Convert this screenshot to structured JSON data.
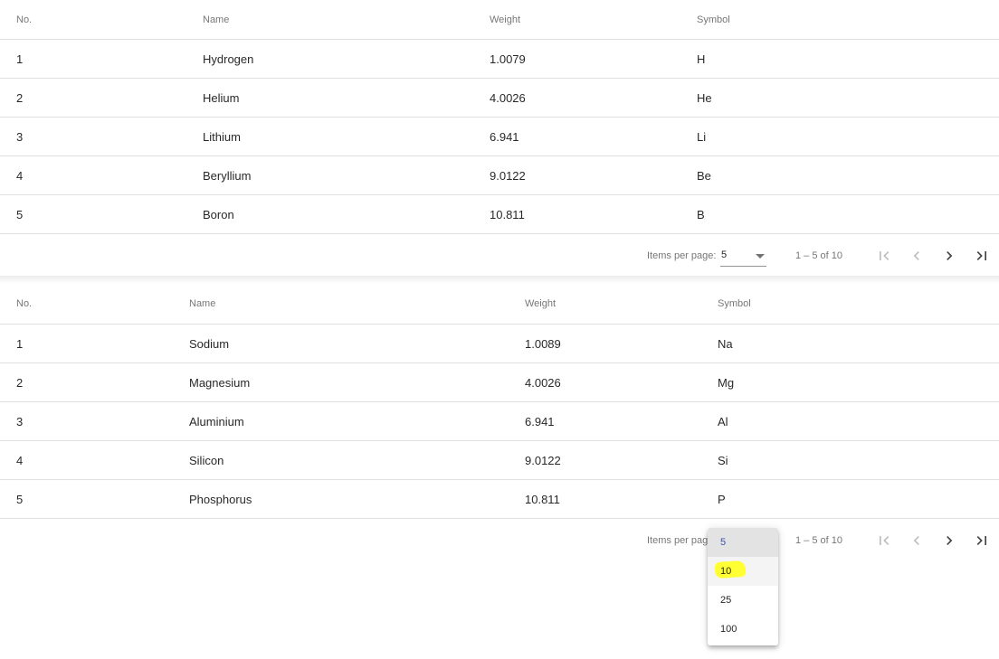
{
  "table1": {
    "headers": {
      "no": "No.",
      "name": "Name",
      "weight": "Weight",
      "symbol": "Symbol"
    },
    "rows": [
      {
        "no": "1",
        "name": "Hydrogen",
        "weight": "1.0079",
        "symbol": "H"
      },
      {
        "no": "2",
        "name": "Helium",
        "weight": "4.0026",
        "symbol": "He"
      },
      {
        "no": "3",
        "name": "Lithium",
        "weight": "6.941",
        "symbol": "Li"
      },
      {
        "no": "4",
        "name": "Beryllium",
        "weight": "9.0122",
        "symbol": "Be"
      },
      {
        "no": "5",
        "name": "Boron",
        "weight": "10.811",
        "symbol": "B"
      }
    ],
    "paginator": {
      "items_per_page_label": "Items per page:",
      "page_size": "5",
      "range_label": "1 – 5 of 10"
    }
  },
  "table2": {
    "headers": {
      "no": "No.",
      "name": "Name",
      "weight": "Weight",
      "symbol": "Symbol"
    },
    "rows": [
      {
        "no": "1",
        "name": "Sodium",
        "weight": "1.0089",
        "symbol": "Na"
      },
      {
        "no": "2",
        "name": "Magnesium",
        "weight": "4.0026",
        "symbol": "Mg"
      },
      {
        "no": "3",
        "name": "Aluminium",
        "weight": "6.941",
        "symbol": "Al"
      },
      {
        "no": "4",
        "name": "Silicon",
        "weight": "9.0122",
        "symbol": "Si"
      },
      {
        "no": "5",
        "name": "Phosphorus",
        "weight": "10.811",
        "symbol": "P"
      }
    ],
    "paginator": {
      "items_per_page_label": "Items per pag",
      "page_size": "5",
      "range_label": "1 – 5 of 10"
    }
  },
  "dropdown": {
    "options": [
      "5",
      "10",
      "25",
      "100"
    ],
    "selected": "5",
    "highlighted": "10"
  },
  "colors": {
    "selected_option_text": "#3f51b5",
    "highlight_marker": "#ffff33"
  },
  "icons": {
    "first": "first-page-icon",
    "prev": "chevron-left-icon",
    "next": "chevron-right-icon",
    "last": "last-page-icon"
  }
}
